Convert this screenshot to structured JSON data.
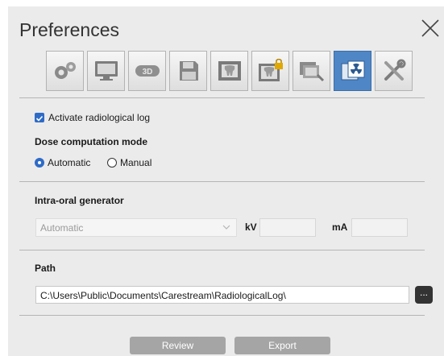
{
  "window": {
    "title": "Preferences",
    "close_icon": "close-icon"
  },
  "toolbar": {
    "tabs": [
      {
        "icon": "gears-icon",
        "active": false
      },
      {
        "icon": "monitor-icon",
        "active": false
      },
      {
        "icon": "3d-icon",
        "active": false
      },
      {
        "icon": "floppy-disk-icon",
        "active": false
      },
      {
        "icon": "tooth-frame-icon",
        "active": false
      },
      {
        "icon": "tooth-frame-lock-icon",
        "active": false
      },
      {
        "icon": "image-settings-icon",
        "active": false
      },
      {
        "icon": "radiation-log-icon",
        "active": true
      },
      {
        "icon": "tools-icon",
        "active": false
      }
    ],
    "active_color": "#4f86c6"
  },
  "log": {
    "activate_label": "Activate radiological log",
    "activate_checked": true
  },
  "dose": {
    "heading": "Dose computation mode",
    "options": [
      "Automatic",
      "Manual"
    ],
    "selected": "Automatic"
  },
  "generator": {
    "heading": "Intra-oral generator",
    "selected": "Automatic",
    "kv_label": "kV",
    "kv_value": "",
    "ma_label": "mA",
    "ma_value": ""
  },
  "path": {
    "heading": "Path",
    "value": "C:\\Users\\Public\\Documents\\Carestream\\RadiologicalLog\\",
    "browse_label": "..."
  },
  "actions": {
    "review_label": "Review",
    "export_label": "Export"
  },
  "colors": {
    "accent": "#2e6bc7",
    "button": "#a5a5a5"
  }
}
